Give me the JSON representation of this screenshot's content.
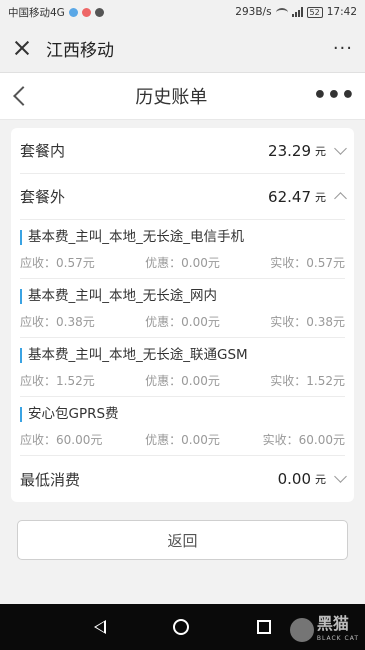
{
  "status_bar": {
    "carrier": "中国移动4G",
    "speed": "293B/s",
    "battery": "52",
    "time": "17:42"
  },
  "top_bar": {
    "title": "江西移动",
    "more": "···"
  },
  "page": {
    "title": "历史账单",
    "more": "•••"
  },
  "summary": {
    "inside_label": "套餐内",
    "inside_amount": "23.29",
    "outside_label": "套餐外",
    "outside_amount": "62.47",
    "unit": "元"
  },
  "details": [
    {
      "name": "基本费_主叫_本地_无长途_电信手机",
      "receivable": "应收：0.57元",
      "discount": "优惠：0.00元",
      "actual": "实收：0.57元"
    },
    {
      "name": "基本费_主叫_本地_无长途_网内",
      "receivable": "应收：0.38元",
      "discount": "优惠：0.00元",
      "actual": "实收：0.38元"
    },
    {
      "name": "基本费_主叫_本地_无长途_联通GSM",
      "receivable": "应收：1.52元",
      "discount": "优惠：0.00元",
      "actual": "实收：1.52元"
    },
    {
      "name": "安心包GPRS费",
      "receivable": "应收：60.00元",
      "discount": "优惠：0.00元",
      "actual": "实收：60.00元"
    }
  ],
  "minimum": {
    "label": "最低消费",
    "amount": "0.00"
  },
  "return_button": "返回",
  "watermark": {
    "cn": "黑猫",
    "en": "BLACK CAT"
  },
  "colors": {
    "accent_bar": "#3aa3e3",
    "nav_bg": "#0a0a0a"
  }
}
